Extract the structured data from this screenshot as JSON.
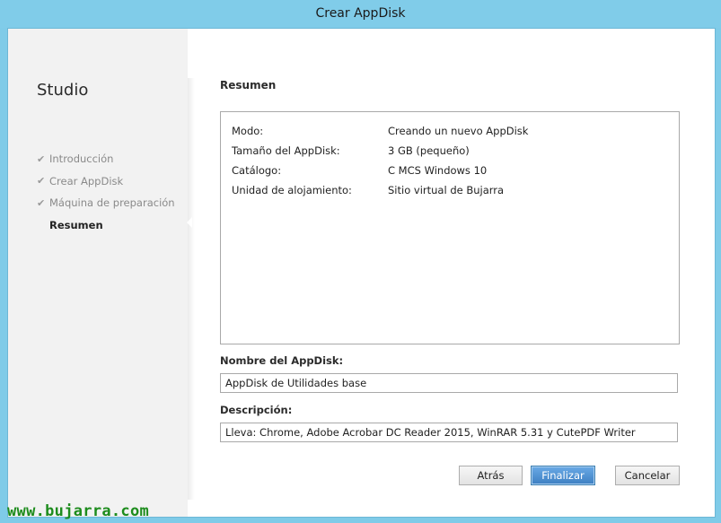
{
  "window": {
    "title": "Crear AppDisk"
  },
  "sidebar": {
    "title": "Studio",
    "steps": [
      {
        "label": "Introducción",
        "done": true
      },
      {
        "label": "Crear AppDisk",
        "done": true
      },
      {
        "label": "Máquina de preparación",
        "done": true
      },
      {
        "label": "Resumen",
        "done": false,
        "current": true
      }
    ]
  },
  "main": {
    "heading": "Resumen",
    "summary": [
      {
        "key": "Modo:",
        "value": "Creando un nuevo AppDisk"
      },
      {
        "key": "Tamaño del AppDisk:",
        "value": "3 GB (pequeño)"
      },
      {
        "key": "Catálogo:",
        "value": "C MCS Windows 10"
      },
      {
        "key": "Unidad de alojamiento:",
        "value": "Sitio virtual de Bujarra"
      }
    ],
    "name_label": "Nombre del AppDisk:",
    "name_value": "AppDisk de Utilidades base",
    "description_label": "Descripción:",
    "description_value": "Lleva: Chrome, Adobe Acrobar DC Reader 2015, WinRAR 5.31 y CutePDF Writer"
  },
  "buttons": {
    "back": "Atrás",
    "finish": "Finalizar",
    "cancel": "Cancelar"
  },
  "watermark": "www.bujarra.com",
  "icons": {
    "step_done": "check-icon"
  }
}
